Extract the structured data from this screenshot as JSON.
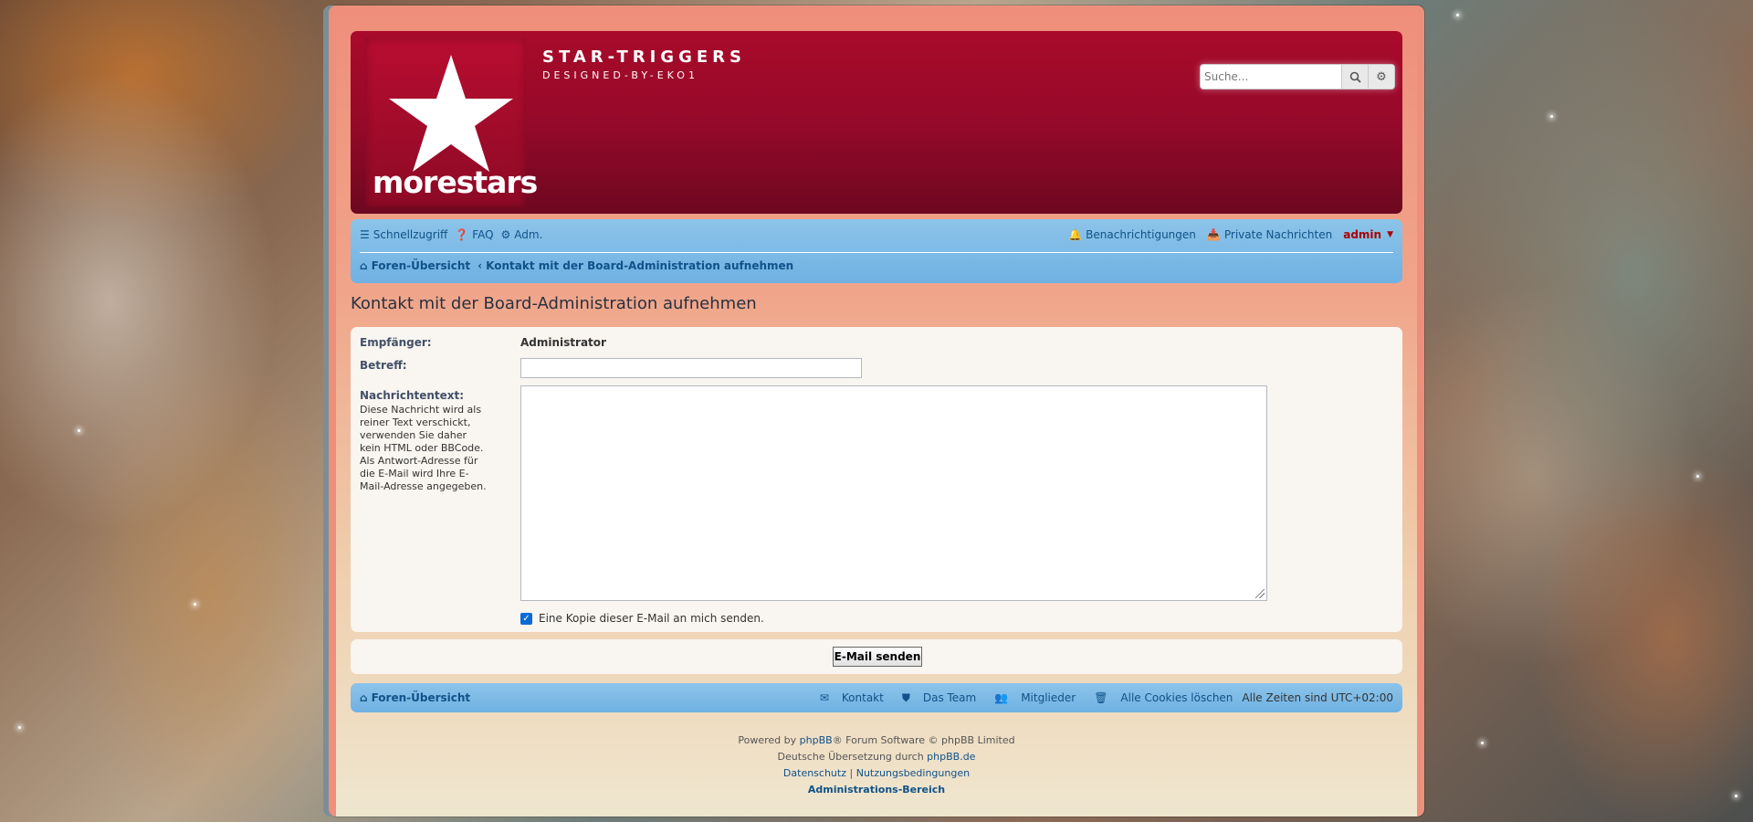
{
  "site": {
    "title": "STAR-TRIGGERS",
    "subtitle": "DESIGNED-BY-EKO1",
    "logo_text": "morestars"
  },
  "search": {
    "placeholder": "Suche..."
  },
  "nav": {
    "quicklinks": "Schnellzugriff",
    "faq": "FAQ",
    "acp": "Adm.",
    "notifications": "Benachrichtigungen",
    "pm": "Private Nachrichten",
    "username": "admin"
  },
  "breadcrumb": {
    "home": "Foren-Übersicht",
    "current": "Kontakt mit der Board-Administration aufnehmen"
  },
  "page_title": "Kontakt mit der Board-Administration aufnehmen",
  "form": {
    "recipient_label": "Empfänger:",
    "recipient_value": "Administrator",
    "subject_label": "Betreff:",
    "subject_value": "",
    "message_label": "Nachrichtentext:",
    "message_help": "Diese Nachricht wird als reiner Text verschickt, verwenden Sie daher kein HTML oder BBCode. Als Antwort-Adresse für die E-Mail wird Ihre E-Mail-Adresse angegeben.",
    "message_value": "",
    "copy_label": "Eine Kopie dieser E-Mail an mich senden.",
    "copy_checked": true,
    "submit_label": "E-Mail senden"
  },
  "footer_nav": {
    "home": "Foren-Übersicht",
    "contact": "Kontakt",
    "team": "Das Team",
    "members": "Mitglieder",
    "delete_cookies": "Alle Cookies löschen",
    "timezone": "Alle Zeiten sind UTC+02:00"
  },
  "copyright": {
    "powered_prefix": "Powered by",
    "phpbb": "phpBB",
    "powered_suffix": "® Forum Software © phpBB Limited",
    "translation_prefix": "Deutsche Übersetzung durch",
    "translation_link": "phpBB.de",
    "privacy": "Datenschutz",
    "separator": "|",
    "terms": "Nutzungsbedingungen",
    "acp_link": "Administrations-Bereich"
  },
  "colors": {
    "header_red": "#a90a2a",
    "nav_blue": "#8cc4e9",
    "link_blue": "#105289",
    "username_red": "#aa0000"
  }
}
